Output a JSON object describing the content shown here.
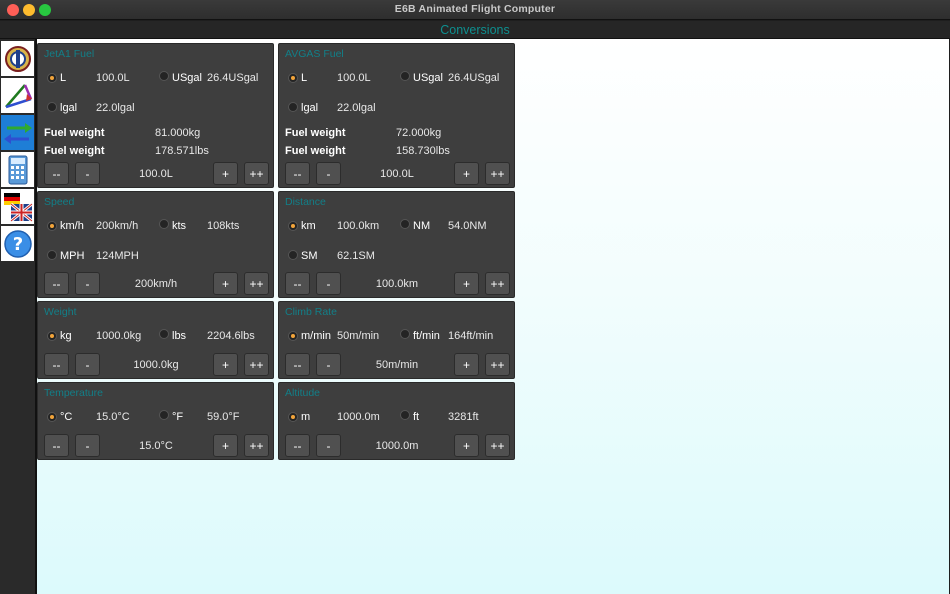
{
  "window": {
    "title": "E6B Animated Flight Computer"
  },
  "section": {
    "title": "Conversions"
  },
  "sidebar": {
    "items": [
      {
        "name": "e6b-logo-icon",
        "active": false
      },
      {
        "name": "triangle-icon",
        "active": false
      },
      {
        "name": "arrows-icon",
        "active": true
      },
      {
        "name": "calculator-icon",
        "active": false
      },
      {
        "name": "flags-icon",
        "active": false
      },
      {
        "name": "help-icon",
        "active": false
      }
    ]
  },
  "buttons": {
    "dec2": "--",
    "dec1": "-",
    "inc1": "+",
    "inc2": "++"
  },
  "panels": {
    "jeta1": {
      "title": "JetA1 Fuel",
      "r1": {
        "unit": "L",
        "value": "100.0L"
      },
      "r2": {
        "unit": "USgal",
        "value": "26.4USgal"
      },
      "r3": {
        "unit": "lgal",
        "value": "22.0lgal"
      },
      "fuel_label": "Fuel weight",
      "w1": "81.000kg",
      "w2": "178.571lbs",
      "display": "100.0L"
    },
    "avgas": {
      "title": "AVGAS Fuel",
      "r1": {
        "unit": "L",
        "value": "100.0L"
      },
      "r2": {
        "unit": "USgal",
        "value": "26.4USgal"
      },
      "r3": {
        "unit": "lgal",
        "value": "22.0lgal"
      },
      "fuel_label": "Fuel weight",
      "w1": "72.000kg",
      "w2": "158.730lbs",
      "display": "100.0L"
    },
    "speed": {
      "title": "Speed",
      "r1": {
        "unit": "km/h",
        "value": "200km/h"
      },
      "r2": {
        "unit": "kts",
        "value": "108kts"
      },
      "r3": {
        "unit": "MPH",
        "value": "124MPH"
      },
      "display": "200km/h"
    },
    "distance": {
      "title": "Distance",
      "r1": {
        "unit": "km",
        "value": "100.0km"
      },
      "r2": {
        "unit": "NM",
        "value": "54.0NM"
      },
      "r3": {
        "unit": "SM",
        "value": "62.1SM"
      },
      "display": "100.0km"
    },
    "weight": {
      "title": "Weight",
      "r1": {
        "unit": "kg",
        "value": "1000.0kg"
      },
      "r2": {
        "unit": "lbs",
        "value": "2204.6lbs"
      },
      "display": "1000.0kg"
    },
    "climb": {
      "title": "Climb Rate",
      "r1": {
        "unit": "m/min",
        "value": "50m/min"
      },
      "r2": {
        "unit": "ft/min",
        "value": "164ft/min"
      },
      "display": "50m/min"
    },
    "temperature": {
      "title": "Temperature",
      "r1": {
        "unit": "°C",
        "value": "15.0°C"
      },
      "r2": {
        "unit": "°F",
        "value": "59.0°F"
      },
      "display": "15.0°C"
    },
    "altitude": {
      "title": "Altitude",
      "r1": {
        "unit": "m",
        "value": "1000.0m"
      },
      "r2": {
        "unit": "ft",
        "value": "3281ft"
      },
      "display": "1000.0m"
    }
  }
}
